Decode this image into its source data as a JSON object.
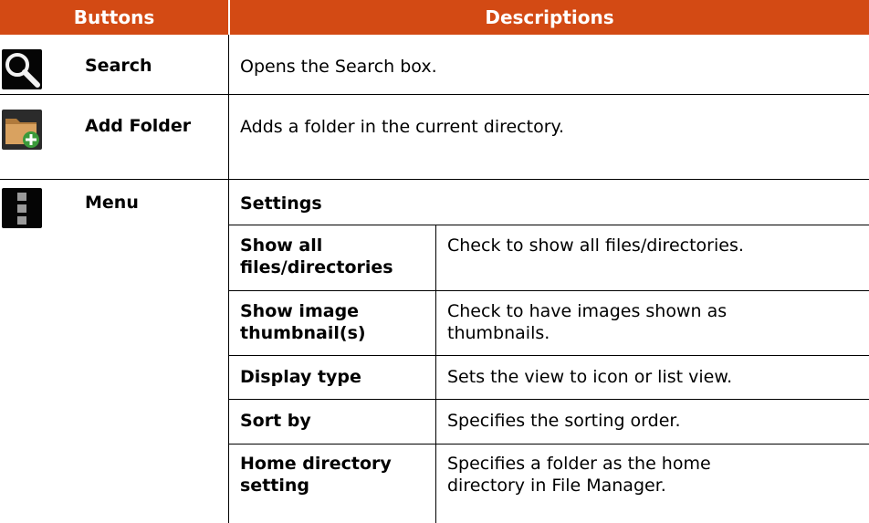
{
  "headers": {
    "buttons": "Buttons",
    "descriptions": "Descriptions"
  },
  "rows": {
    "search": {
      "button": "Search",
      "description": "Opens the Search box.",
      "icon": "search-icon"
    },
    "add_folder": {
      "button": "Add Folder",
      "description": "Adds a folder in the current directory.",
      "icon": "add-folder-icon"
    },
    "menu": {
      "button": "Menu",
      "icon": "menu-icon",
      "section": "Settings"
    }
  },
  "settings": [
    {
      "option_lines": [
        "Show all",
        "files/directories"
      ],
      "description_lines": [
        "Check to show all files/directories."
      ]
    },
    {
      "option_lines": [
        "Show image",
        "thumbnail(s)"
      ],
      "description_lines": [
        "Check to have images shown as",
        "thumbnails."
      ]
    },
    {
      "option_lines": [
        "Display type"
      ],
      "description_lines": [
        "Sets the view to icon or list view."
      ]
    },
    {
      "option_lines": [
        "Sort by"
      ],
      "description_lines": [
        "Specifies the sorting order."
      ]
    },
    {
      "option_lines": [
        "Home directory",
        "setting"
      ],
      "description_lines": [
        "Specifies a folder as the home",
        "directory in File Manager."
      ]
    }
  ],
  "colors": {
    "header_bg": "#d34a14",
    "header_text": "#ffffff"
  }
}
